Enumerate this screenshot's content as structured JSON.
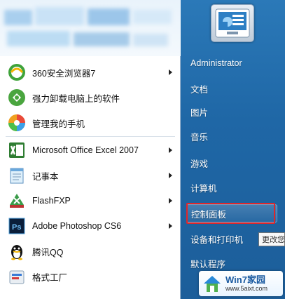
{
  "left_menu": [
    {
      "label": "360安全浏览器7",
      "icon": "360-browser-icon",
      "has_arrow": true
    },
    {
      "label": "强力卸载电脑上的软件",
      "icon": "uninstall-software-icon",
      "has_arrow": false
    },
    {
      "label": "管理我的手机",
      "icon": "phone-manager-icon",
      "has_arrow": false
    },
    {
      "label": "Microsoft Office Excel 2007",
      "icon": "excel-icon",
      "has_arrow": true
    },
    {
      "label": "记事本",
      "icon": "notepad-icon",
      "has_arrow": true
    },
    {
      "label": "FlashFXP",
      "icon": "flashfxp-icon",
      "has_arrow": true
    },
    {
      "label": "Adobe Photoshop CS6",
      "icon": "photoshop-icon",
      "has_arrow": true
    },
    {
      "label": "腾讯QQ",
      "icon": "qq-icon",
      "has_arrow": false
    },
    {
      "label": "格式工厂",
      "icon": "format-factory-icon",
      "has_arrow": false
    }
  ],
  "right_menu": {
    "user": "Administrator",
    "documents": "文档",
    "pictures": "图片",
    "music": "音乐",
    "games": "游戏",
    "computer": "计算机",
    "control_panel": "控制面板",
    "devices_printers": "设备和打印机",
    "default_programs": "默认程序"
  },
  "tooltip": "更改您",
  "watermark": {
    "title": "Win7家园",
    "url": "www.5aixt.com"
  },
  "colors": {
    "highlight_box": "#e0262a",
    "right_panel": "#1f67a6"
  }
}
